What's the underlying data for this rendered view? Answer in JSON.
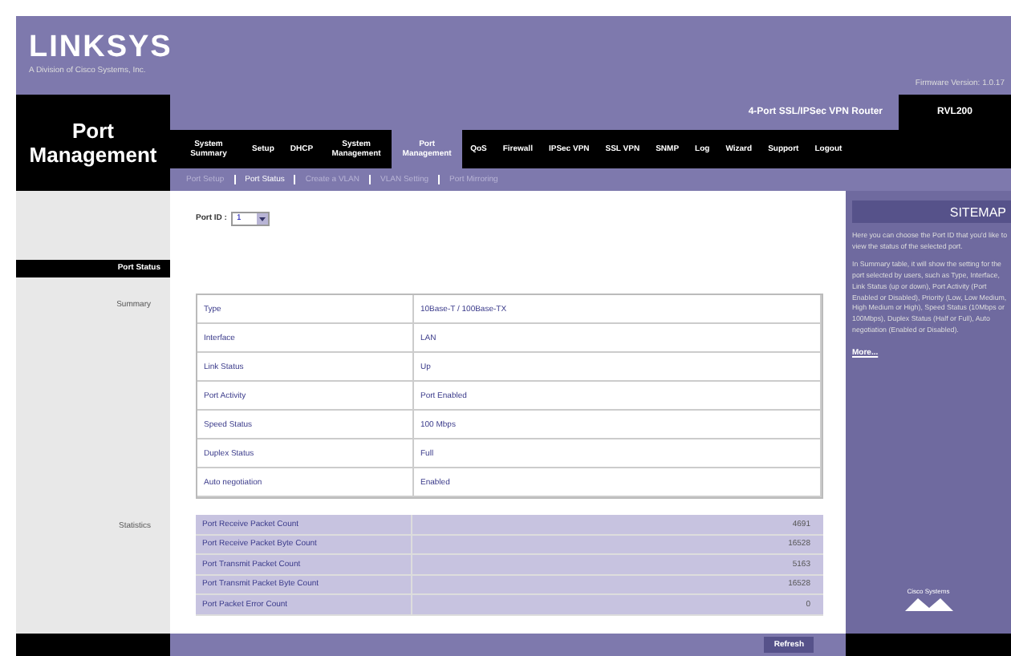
{
  "brand": {
    "logo": "LINKSYS",
    "tagline": "A Division of Cisco Systems, Inc.",
    "firmware": "Firmware Version: 1.0.17"
  },
  "section_title": "Port Management",
  "product": {
    "name": "4-Port SSL/IPSec VPN Router",
    "model": "RVL200"
  },
  "tabs": [
    {
      "label": "System Summary",
      "selected": false
    },
    {
      "label": "Setup",
      "selected": false
    },
    {
      "label": "DHCP",
      "selected": false
    },
    {
      "label": "System Management",
      "selected": false
    },
    {
      "label": "Port Management",
      "selected": true
    },
    {
      "label": "QoS",
      "selected": false
    },
    {
      "label": "Firewall",
      "selected": false
    },
    {
      "label": "IPSec VPN",
      "selected": false
    },
    {
      "label": "SSL VPN",
      "selected": false
    },
    {
      "label": "SNMP",
      "selected": false
    },
    {
      "label": "Log",
      "selected": false
    },
    {
      "label": "Wizard",
      "selected": false
    },
    {
      "label": "Support",
      "selected": false
    },
    {
      "label": "Logout",
      "selected": false
    }
  ],
  "subtabs": [
    {
      "label": "Port Setup",
      "selected": false
    },
    {
      "label": "Port Status",
      "selected": true
    },
    {
      "label": "Create a VLAN",
      "selected": false
    },
    {
      "label": "VLAN Setting",
      "selected": false
    },
    {
      "label": "Port Mirroring",
      "selected": false
    }
  ],
  "page_heading": "Port Status",
  "port_id": {
    "label": "Port ID :",
    "value": "1"
  },
  "summary": {
    "label": "Summary",
    "rows": [
      {
        "name": "Type",
        "value": "10Base-T / 100Base-TX"
      },
      {
        "name": "Interface",
        "value": "LAN"
      },
      {
        "name": "Link Status",
        "value": "Up"
      },
      {
        "name": "Port Activity",
        "value": "Port Enabled"
      },
      {
        "name": "Speed Status",
        "value": "100 Mbps"
      },
      {
        "name": "Duplex Status",
        "value": "Full"
      },
      {
        "name": "Auto negotiation",
        "value": "Enabled"
      }
    ]
  },
  "statistics": {
    "label": "Statistics",
    "rows": [
      {
        "name": "Port Receive Packet Count",
        "value": "4691"
      },
      {
        "name": "Port Receive Packet Byte Count",
        "value": "16528"
      },
      {
        "name": "Port Transmit Packet Count",
        "value": "5163"
      },
      {
        "name": "Port Transmit Packet Byte Count",
        "value": "16528"
      },
      {
        "name": "Port Packet Error Count",
        "value": "0"
      }
    ]
  },
  "refresh_button": "Refresh",
  "sitemap": {
    "title": "SITEMAP",
    "paragraphs": [
      "Here you can choose the Port ID that you'd like to view the status of the selected port.",
      "In Summary table, it will show the setting for the port selected by users, such as Type, Interface, Link Status (up or down), Port Activity (Port Enabled or Disabled), Priority (Low, Low Medium, High Medium or High), Speed Status (10Mbps or 100Mbps), Duplex Status (Half or Full), Auto negotiation (Enabled or Disabled)."
    ],
    "more": "More..."
  },
  "cisco_logo": "Cisco Systems"
}
